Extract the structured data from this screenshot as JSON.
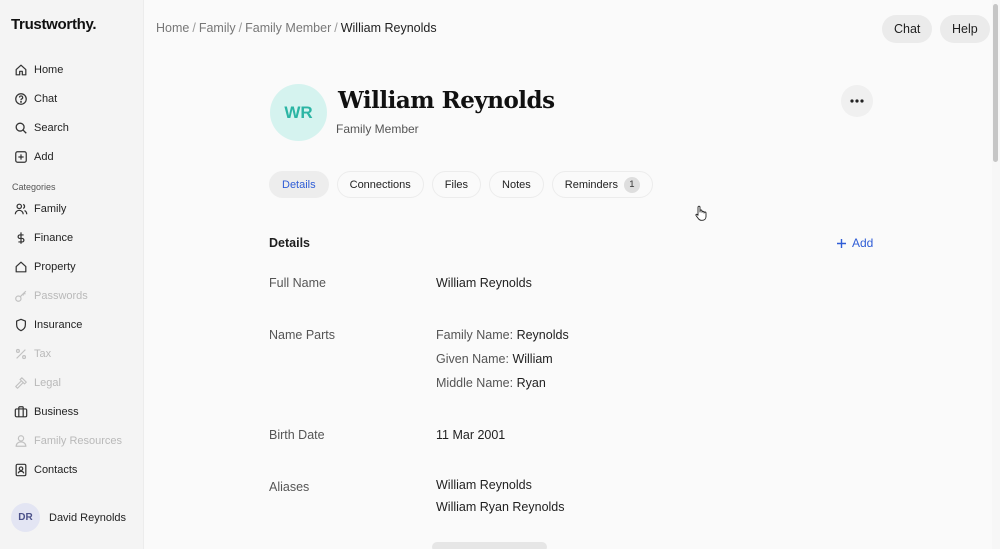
{
  "app": {
    "logo": "Trustworthy."
  },
  "sidebar": {
    "items": [
      {
        "label": "Home",
        "icon": "home-icon",
        "disabled": false
      },
      {
        "label": "Chat",
        "icon": "chat-icon",
        "disabled": false
      },
      {
        "label": "Search",
        "icon": "search-icon",
        "disabled": false
      },
      {
        "label": "Add",
        "icon": "add-icon",
        "disabled": false
      }
    ],
    "section_label": "Categories",
    "categories": [
      {
        "label": "Family",
        "icon": "family-icon",
        "disabled": false
      },
      {
        "label": "Finance",
        "icon": "dollar-icon",
        "disabled": false
      },
      {
        "label": "Property",
        "icon": "house-icon",
        "disabled": false
      },
      {
        "label": "Passwords",
        "icon": "key-icon",
        "disabled": true
      },
      {
        "label": "Insurance",
        "icon": "shield-icon",
        "disabled": false
      },
      {
        "label": "Tax",
        "icon": "percent-icon",
        "disabled": true
      },
      {
        "label": "Legal",
        "icon": "gavel-icon",
        "disabled": true
      },
      {
        "label": "Business",
        "icon": "briefcase-icon",
        "disabled": false
      },
      {
        "label": "Family Resources",
        "icon": "person-resources-icon",
        "disabled": true
      },
      {
        "label": "Contacts",
        "icon": "contacts-icon",
        "disabled": false
      }
    ],
    "user": {
      "initials": "DR",
      "name": "David Reynolds"
    }
  },
  "breadcrumb": {
    "home": "Home",
    "family": "Family",
    "family_member": "Family Member",
    "current": "William Reynolds",
    "separator": "/"
  },
  "top_actions": {
    "chat": "Chat",
    "help": "Help"
  },
  "profile": {
    "initials": "WR",
    "name": "William Reynolds",
    "type": "Family Member"
  },
  "tabs": [
    {
      "label": "Details",
      "active": true
    },
    {
      "label": "Connections",
      "active": false
    },
    {
      "label": "Files",
      "active": false
    },
    {
      "label": "Notes",
      "active": false
    },
    {
      "label": "Reminders",
      "active": false,
      "badge": "1"
    }
  ],
  "details": {
    "title": "Details",
    "add_label": "Add",
    "full_name": {
      "label": "Full Name",
      "value": "William Reynolds"
    },
    "name_parts": {
      "label": "Name Parts",
      "family_key": "Family Name:",
      "family_value": "Reynolds",
      "given_key": "Given Name:",
      "given_value": "William",
      "middle_key": "Middle Name:",
      "middle_value": "Ryan"
    },
    "birth_date": {
      "label": "Birth Date",
      "value": "11 Mar 2001"
    },
    "aliases": {
      "label": "Aliases",
      "values": [
        "William Reynolds",
        "William Ryan Reynolds"
      ]
    }
  },
  "colors": {
    "accent": "#2f5dd6",
    "avatar_bg": "#d5f3ef",
    "avatar_text": "#2bb5a4",
    "user_avatar_bg": "#e3e5f3"
  }
}
